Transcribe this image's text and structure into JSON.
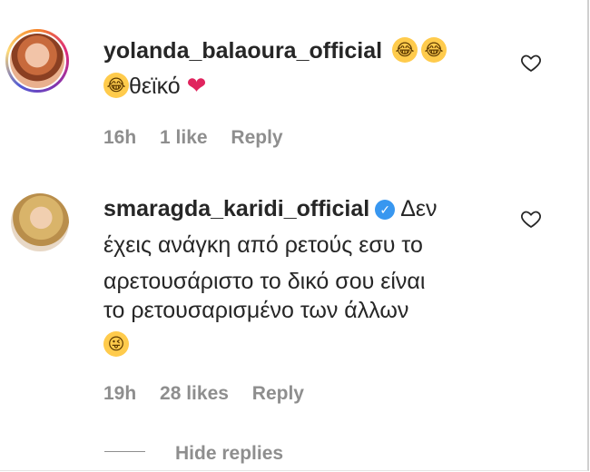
{
  "comments": [
    {
      "username": "yolanda_balaoura_official",
      "text": "θεϊκό",
      "time": "16h",
      "likes": "1 like",
      "reply": "Reply"
    },
    {
      "username": "smaragda_karidi_official",
      "text_line1": "Δεν",
      "text_line2": "έχεις ανάγκη από ρετούς εσυ το",
      "text_line3": "αρετουσάριστο το δικό σου είναι",
      "text_line4": "το ρετουσαρισμένο των άλλων",
      "time": "19h",
      "likes": "28 likes",
      "reply": "Reply"
    }
  ],
  "hide_replies": "Hide replies",
  "icons": {
    "like": "heart-outline-icon",
    "verified": "verified-badge-icon"
  }
}
